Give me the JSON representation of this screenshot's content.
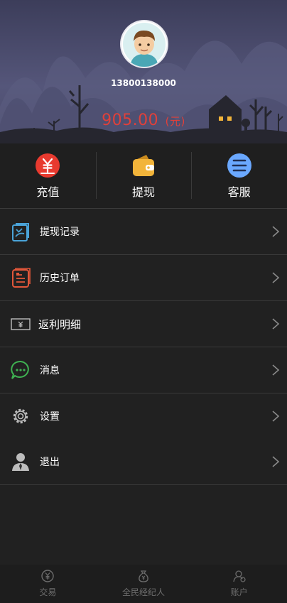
{
  "profile": {
    "phone": "13800138000",
    "balance": "905.00",
    "unit": "(元)"
  },
  "actions": [
    {
      "label": "充值",
      "icon": "yen-recharge-icon"
    },
    {
      "label": "提现",
      "icon": "wallet-icon"
    },
    {
      "label": "客服",
      "icon": "menu-lines-icon"
    }
  ],
  "menu": [
    {
      "label": "提现记录",
      "icon": "withdraw-record-icon"
    },
    {
      "label": "历史订单",
      "icon": "order-history-icon"
    },
    {
      "label": "返利明细",
      "icon": "rebate-bill-icon"
    },
    {
      "label": "消息",
      "icon": "chat-bubble-icon"
    },
    {
      "label": "设置",
      "icon": "gear-icon"
    },
    {
      "label": "退出",
      "icon": "user-logout-icon"
    }
  ],
  "tabs": [
    {
      "label": "交易",
      "icon": "trade-yen-icon"
    },
    {
      "label": "全民经纪人",
      "icon": "money-bag-icon"
    },
    {
      "label": "账户",
      "icon": "account-icon"
    }
  ],
  "colors": {
    "balance": "#e0403a",
    "recharge": "#e83a2f",
    "wallet": "#f2b43a",
    "service": "#6aa8ff"
  }
}
